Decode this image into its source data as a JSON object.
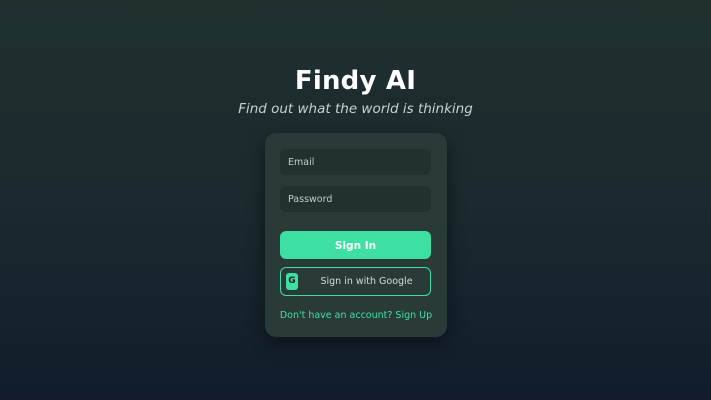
{
  "app": {
    "title": "Findy AI",
    "tagline": "Find out what the world is thinking"
  },
  "login_form": {
    "email": {
      "value": "",
      "placeholder": "Email"
    },
    "password": {
      "value": "",
      "placeholder": "Password"
    },
    "sign_in_label": "Sign In",
    "google_button": {
      "icon": "google-icon",
      "icon_glyph": "G",
      "label": "Sign in with Google"
    },
    "signup_prompt": "Don't have an account? Sign Up"
  },
  "colors": {
    "accent": "#3de0a2",
    "card_background": "#2a3a39",
    "field_background": "#223130",
    "page_background_top": "#1f302f",
    "page_background_bottom": "#121c2c"
  }
}
